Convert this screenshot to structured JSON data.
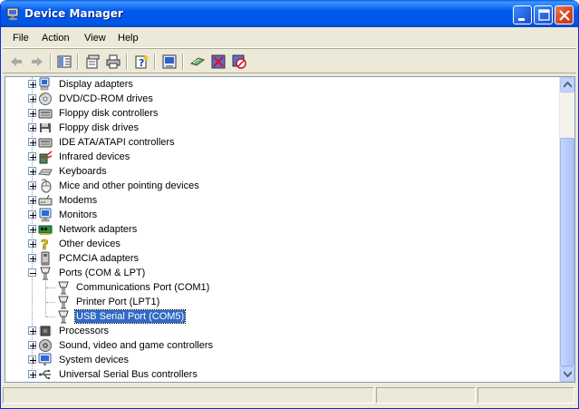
{
  "window": {
    "title": "Device Manager"
  },
  "menu": [
    "File",
    "Action",
    "View",
    "Help"
  ],
  "toolbar": [
    "back-icon",
    "forward-icon",
    "show-hide-tree-icon",
    "properties-icon",
    "print-icon",
    "help-icon",
    "update-driver-icon",
    "scan-hardware-icon",
    "uninstall-icon",
    "disable-icon"
  ],
  "tree": {
    "top_items": [
      {
        "label": "Display adapters",
        "icon": "display-adapter-icon"
      },
      {
        "label": "DVD/CD-ROM drives",
        "icon": "cd-drive-icon"
      },
      {
        "label": "Floppy disk controllers",
        "icon": "disk-controller-icon"
      },
      {
        "label": "Floppy disk drives",
        "icon": "floppy-drive-icon"
      },
      {
        "label": "IDE ATA/ATAPI controllers",
        "icon": "ide-controller-icon"
      },
      {
        "label": "Infrared devices",
        "icon": "infrared-icon"
      },
      {
        "label": "Keyboards",
        "icon": "keyboard-icon"
      },
      {
        "label": "Mice and other pointing devices",
        "icon": "mouse-icon"
      },
      {
        "label": "Modems",
        "icon": "modem-icon"
      },
      {
        "label": "Monitors",
        "icon": "monitor-icon"
      },
      {
        "label": "Network adapters",
        "icon": "network-adapter-icon"
      },
      {
        "label": "Other devices",
        "icon": "unknown-device-icon"
      },
      {
        "label": "PCMCIA adapters",
        "icon": "pcmcia-icon"
      }
    ],
    "ports": {
      "label": "Ports (COM & LPT)",
      "icon": "port-icon",
      "children": [
        {
          "label": "Communications Port (COM1)",
          "icon": "port-icon"
        },
        {
          "label": "Printer Port (LPT1)",
          "icon": "port-icon"
        },
        {
          "label": "USB Serial Port (COM5)",
          "icon": "port-icon",
          "selected": true
        }
      ]
    },
    "bottom_items": [
      {
        "label": "Processors",
        "icon": "processor-icon"
      },
      {
        "label": "Sound, video and game controllers",
        "icon": "sound-icon"
      },
      {
        "label": "System devices",
        "icon": "system-device-icon"
      },
      {
        "label": "Universal Serial Bus controllers",
        "icon": "usb-icon"
      }
    ]
  }
}
